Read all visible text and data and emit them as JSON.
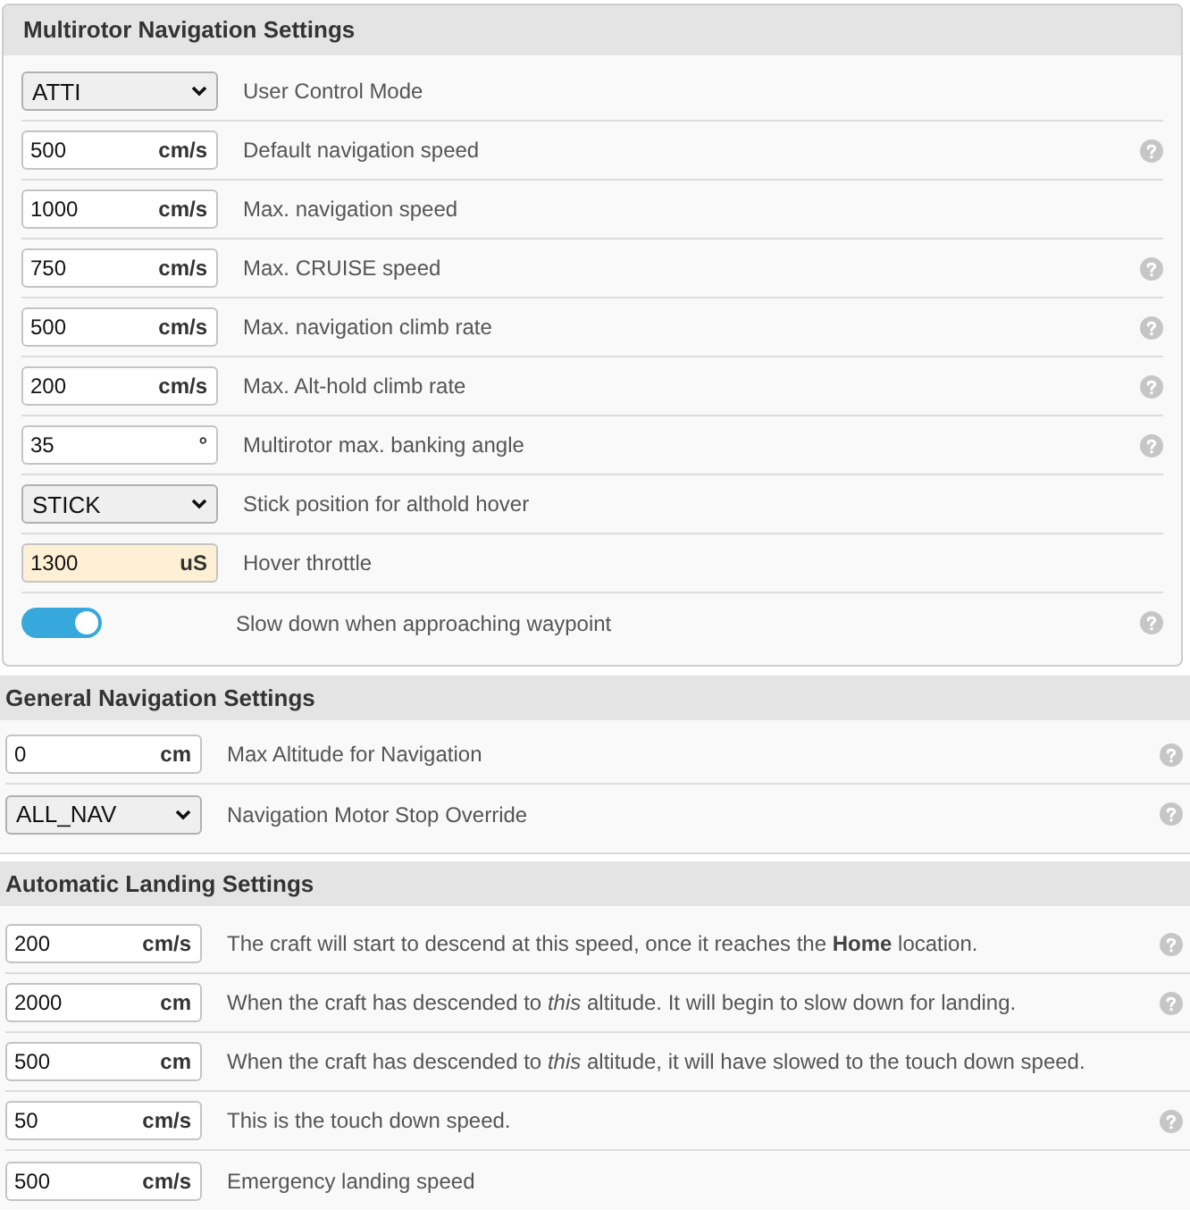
{
  "sections": [
    {
      "kind": "card",
      "title": "Multirotor Navigation Settings",
      "rows": [
        {
          "kind": "select",
          "value": "ATTI",
          "label": "User Control Mode",
          "help": false
        },
        {
          "kind": "number",
          "value": "500",
          "unit": "cm/s",
          "highlighted": false,
          "label": "Default navigation speed",
          "help": true
        },
        {
          "kind": "number",
          "value": "1000",
          "unit": "cm/s",
          "highlighted": false,
          "label": "Max. navigation speed",
          "help": false
        },
        {
          "kind": "number",
          "value": "750",
          "unit": "cm/s",
          "highlighted": false,
          "label": "Max. CRUISE speed",
          "help": true
        },
        {
          "kind": "number",
          "value": "500",
          "unit": "cm/s",
          "highlighted": false,
          "label": "Max. navigation climb rate",
          "help": true
        },
        {
          "kind": "number",
          "value": "200",
          "unit": "cm/s",
          "highlighted": false,
          "label": "Max. Alt-hold climb rate",
          "help": true
        },
        {
          "kind": "number",
          "value": "35",
          "unit": "°",
          "highlighted": false,
          "label": "Multirotor max. banking angle",
          "help": true
        },
        {
          "kind": "select",
          "value": "STICK",
          "label": "Stick position for althold hover",
          "help": false
        },
        {
          "kind": "number",
          "value": "1300",
          "unit": "uS",
          "highlighted": true,
          "label": "Hover throttle",
          "help": false
        },
        {
          "kind": "toggle",
          "on": true,
          "label": "Slow down when approaching waypoint",
          "help": true
        }
      ]
    },
    {
      "kind": "band",
      "title": "General Navigation Settings",
      "rows": [
        {
          "kind": "number",
          "value": "0",
          "unit": "cm",
          "highlighted": false,
          "label": "Max Altitude for Navigation",
          "help": true
        },
        {
          "kind": "select",
          "value": "ALL_NAV",
          "label": "Navigation Motor Stop Override",
          "help": true
        }
      ]
    },
    {
      "kind": "band",
      "title": "Automatic Landing Settings",
      "rows": [
        {
          "kind": "number",
          "value": "200",
          "unit": "cm/s",
          "highlighted": false,
          "label": "The craft will start to descend at this speed, once it reaches the **Home** location.",
          "help": true
        },
        {
          "kind": "number",
          "value": "2000",
          "unit": "cm",
          "highlighted": false,
          "label": "When the craft has descended to *this* altitude. It will begin to slow down for landing.",
          "help": true
        },
        {
          "kind": "number",
          "value": "500",
          "unit": "cm",
          "highlighted": false,
          "label": "When the craft has descended to *this* altitude, it will have slowed to the touch down speed.",
          "help": false
        },
        {
          "kind": "number",
          "value": "50",
          "unit": "cm/s",
          "highlighted": false,
          "label": "This is the touch down speed.",
          "help": true
        },
        {
          "kind": "number",
          "value": "500",
          "unit": "cm/s",
          "highlighted": false,
          "label": "Emergency landing speed",
          "help": false
        }
      ]
    }
  ]
}
